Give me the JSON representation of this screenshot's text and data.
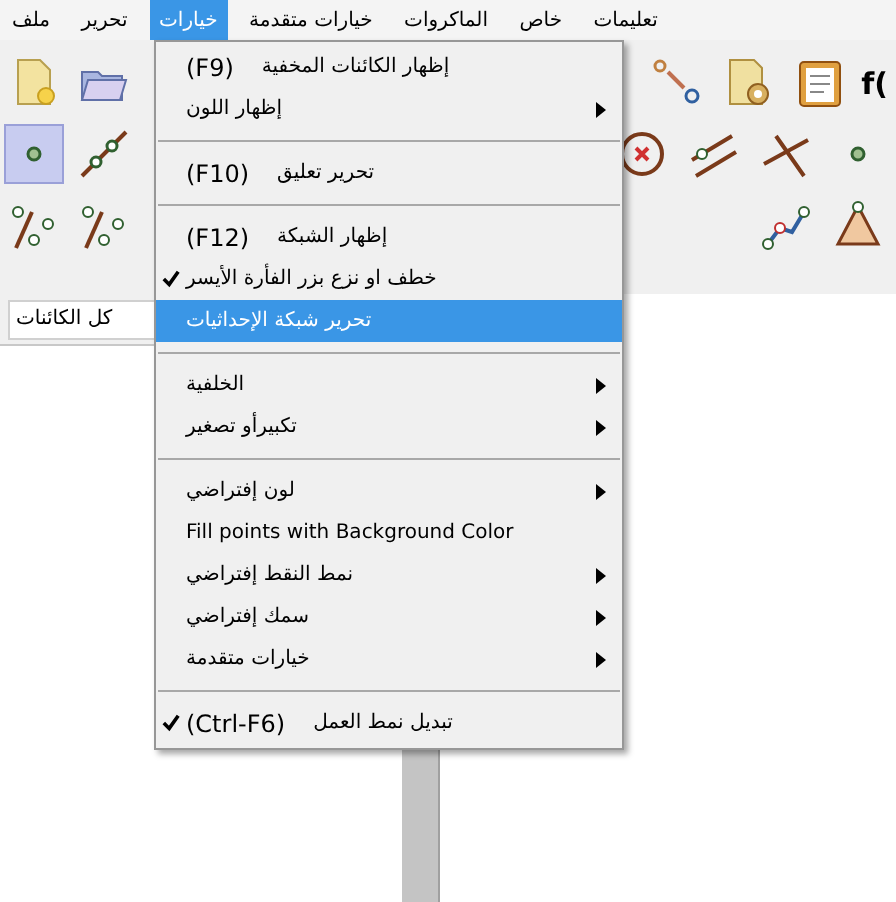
{
  "menubar": [
    {
      "label": "تعليمات",
      "selected": false
    },
    {
      "label": "خاص",
      "selected": false
    },
    {
      "label": "الماكروات",
      "selected": false
    },
    {
      "label": "خيارات متقدمة",
      "selected": false
    },
    {
      "label": "خيارات",
      "selected": true
    },
    {
      "label": "تحرير",
      "selected": false
    },
    {
      "label": "ملف",
      "selected": false
    }
  ],
  "toolbar": {
    "rows": [
      {
        "left": [
          {
            "kind": "new-file",
            "selected": false
          },
          {
            "kind": "open-folder",
            "selected": false
          }
        ],
        "right": [
          {
            "kind": "move-point",
            "selected": false
          },
          {
            "kind": "document-settings",
            "selected": false
          },
          {
            "kind": "clipboard",
            "selected": false
          },
          {
            "kind": "text",
            "label": "f("
          }
        ]
      },
      {
        "left": [
          {
            "kind": "point",
            "selected": true
          },
          {
            "kind": "line",
            "selected": false
          }
        ],
        "right": [
          {
            "kind": "circle-cross",
            "selected": false
          },
          {
            "kind": "parallel",
            "selected": false
          },
          {
            "kind": "perpendicular",
            "selected": false
          },
          {
            "kind": "point",
            "selected": false
          }
        ]
      },
      {
        "left": [
          {
            "kind": "segment-point",
            "selected": false
          },
          {
            "kind": "segment-point",
            "selected": false
          }
        ],
        "right": [
          {
            "kind": "polyline",
            "selected": false
          },
          {
            "kind": "polygon",
            "selected": false
          }
        ]
      }
    ]
  },
  "algebra_panel": {
    "filter": {
      "value": "كل الكائنات"
    }
  },
  "dropdown": {
    "items": [
      {
        "kind": "item",
        "label": "إظهار الكائنات المخفية",
        "shortcut": "(F9)",
        "submenu": false,
        "checked": false,
        "selected": false
      },
      {
        "kind": "item",
        "label": "إظهار اللون",
        "submenu": true,
        "checked": false,
        "selected": false
      },
      {
        "kind": "separator"
      },
      {
        "kind": "item",
        "label": "تحرير تعليق",
        "shortcut": "(F10)",
        "submenu": false,
        "checked": false,
        "selected": false
      },
      {
        "kind": "separator"
      },
      {
        "kind": "item",
        "label": "إظهار الشبكة",
        "shortcut": "(F12)",
        "submenu": false,
        "checked": false,
        "selected": false
      },
      {
        "kind": "item",
        "label": "خطف او نزع بزر الفأرة الأيسر",
        "submenu": false,
        "checked": true,
        "selected": false
      },
      {
        "kind": "item",
        "label": "تحرير شبكة الإحداثيات",
        "submenu": false,
        "checked": false,
        "selected": true
      },
      {
        "kind": "separator"
      },
      {
        "kind": "item",
        "label": "الخلفية",
        "submenu": true,
        "checked": false,
        "selected": false
      },
      {
        "kind": "item",
        "label": "تكبيرأو تصغير",
        "submenu": true,
        "checked": false,
        "selected": false
      },
      {
        "kind": "separator"
      },
      {
        "kind": "item",
        "label": "لون إفتراضي",
        "submenu": true,
        "checked": false,
        "selected": false
      },
      {
        "kind": "item",
        "label": "Fill points with Background Color",
        "submenu": false,
        "checked": false,
        "selected": false
      },
      {
        "kind": "item",
        "label": "نمط النقط إفتراضي",
        "submenu": true,
        "checked": false,
        "selected": false
      },
      {
        "kind": "item",
        "label": "سمك إفتراضي",
        "submenu": true,
        "checked": false,
        "selected": false
      },
      {
        "kind": "item",
        "label": "خيارات متقدمة",
        "submenu": true,
        "checked": false,
        "selected": false
      },
      {
        "kind": "separator"
      },
      {
        "kind": "item",
        "label": "تبديل نمط العمل",
        "shortcut": "(Ctrl-F6)",
        "submenu": false,
        "checked": true,
        "selected": false
      }
    ]
  }
}
